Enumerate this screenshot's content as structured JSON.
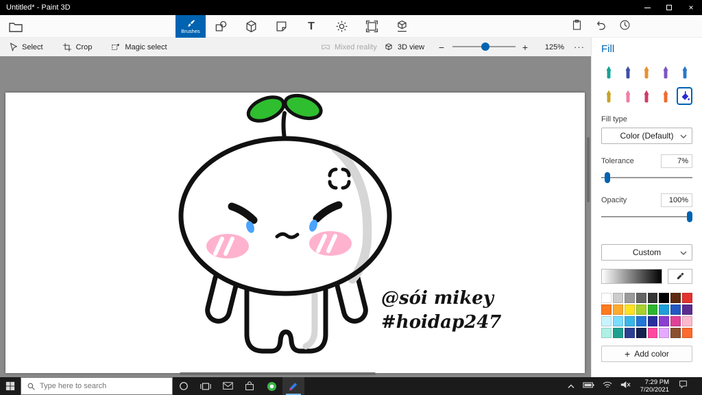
{
  "window": {
    "title": "Untitled* - Paint 3D"
  },
  "appbar": {
    "brushes_label": "Brushes",
    "tools": [
      "menu",
      "brushes",
      "2d-shapes",
      "3d-shapes",
      "stickers",
      "text",
      "effects",
      "canvas",
      "3d-library",
      "paste",
      "undo",
      "history"
    ]
  },
  "toolbar": {
    "select": "Select",
    "crop": "Crop",
    "magic_select": "Magic select",
    "mixed_reality": "Mixed reality",
    "view_3d": "3D view",
    "zoom_out": "−",
    "zoom_in": "+",
    "zoom_level": "125%",
    "more": "···"
  },
  "panel": {
    "title": "Fill",
    "selected_brush": "fill",
    "brushes": [
      {
        "name": "marker",
        "color": "#17a398"
      },
      {
        "name": "calligraphy-pen",
        "color": "#3f51a8"
      },
      {
        "name": "oil-brush",
        "color": "#e8912d"
      },
      {
        "name": "watercolour",
        "color": "#7e57c2"
      },
      {
        "name": "pixel-pen",
        "color": "#2979c8"
      },
      {
        "name": "pencil",
        "color": "#c9a227"
      },
      {
        "name": "eraser",
        "color": "#ef7fa8"
      },
      {
        "name": "crayon",
        "color": "#d23b68"
      },
      {
        "name": "spray-can",
        "color": "#ef6c30"
      },
      {
        "name": "fill",
        "color": "#2b2bd4"
      }
    ],
    "fill_type_label": "Fill type",
    "fill_type_value": "Color (Default)",
    "tolerance_label": "Tolerance",
    "tolerance_value": "7%",
    "tolerance_percent": 7,
    "opacity_label": "Opacity",
    "opacity_value": "100%",
    "opacity_percent": 100,
    "custom_label": "Custom",
    "palette": [
      [
        "#ffffff",
        "#cdcdcd",
        "#9b9b9b",
        "#646464",
        "#353535",
        "#000000",
        "#5f2a10",
        "#e3342f"
      ],
      [
        "#ff7a1f",
        "#ffab2e",
        "#ffe21f",
        "#a9d129",
        "#2eb52e",
        "#1f9fd8",
        "#2257c4",
        "#5b2d90"
      ],
      [
        "#c9f3ff",
        "#7adcff",
        "#38b6e8",
        "#2276d8",
        "#2a2f9e",
        "#8a3fd1",
        "#e04098",
        "#ffb9cf"
      ],
      [
        "#aef0e4",
        "#1fa08f",
        "#2b3f94",
        "#14204d",
        "#ff49a0",
        "#e5aaff",
        "#8a5030",
        "#ff6a2e"
      ]
    ],
    "add_color_label": "Add color"
  },
  "canvas": {
    "texts": [
      "@sói mikey",
      "#hoidap247"
    ]
  },
  "taskbar": {
    "search_placeholder": "Type here to search",
    "time": "7:29 PM",
    "date": "7/20/2021"
  },
  "colors": {
    "accent": "#0063b1",
    "workspace_bg": "#8a8a8a",
    "taskbar_bg": "#1b1b1b"
  },
  "icons": {
    "titlebar": [
      "minimize-icon",
      "maximize-icon",
      "close-icon"
    ],
    "tray": [
      "chevron-up-icon",
      "battery-icon",
      "network-icon",
      "volume-muted-icon",
      "action-center-icon"
    ]
  }
}
